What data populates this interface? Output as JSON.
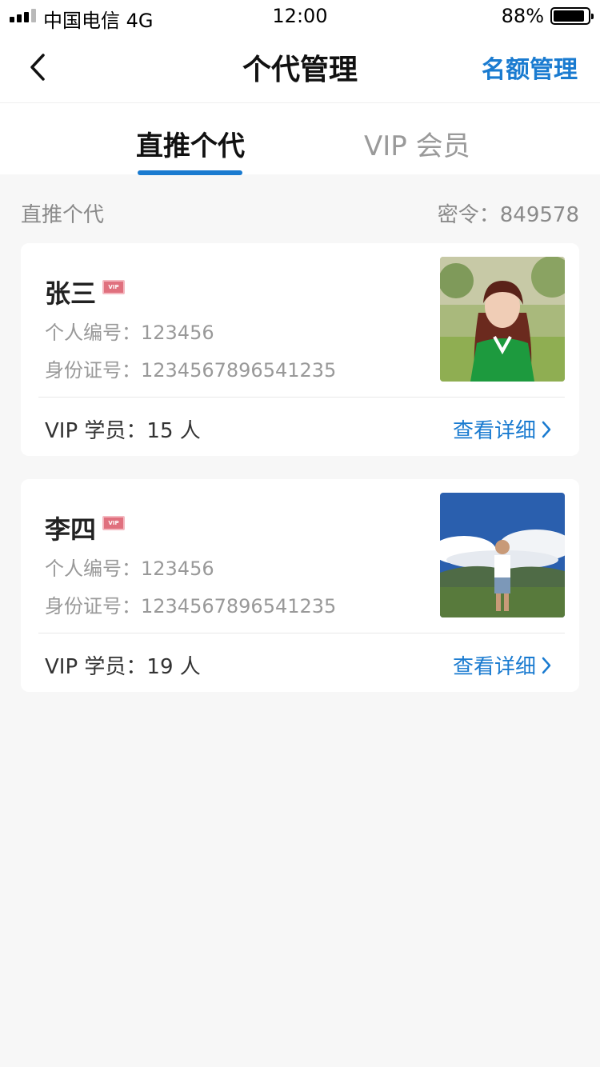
{
  "status_bar": {
    "carrier": "中国电信  4G",
    "time": "12:00",
    "battery": "88%"
  },
  "nav": {
    "title": "个代管理",
    "right_action": "名额管理"
  },
  "tabs": [
    {
      "label": "直推个代",
      "active": true
    },
    {
      "label": "VIP 会员",
      "active": false
    }
  ],
  "section": {
    "label": "直推个代",
    "code": "密令：849578"
  },
  "members": [
    {
      "name": "张三",
      "badge": "VIP",
      "id_line": "个人编号：123456",
      "idcard_line": "身份证号：1234567896541235",
      "students": "VIP 学员：15 人",
      "detail": "查看详细"
    },
    {
      "name": "李四",
      "badge": "VIP",
      "id_line": "个人编号：123456",
      "idcard_line": "身份证号：1234567896541235",
      "students": "VIP 学员：19 人",
      "detail": "查看详细"
    }
  ],
  "colors": {
    "accent": "#1a7bd0",
    "background": "#f7f7f7",
    "badge": "#e0707e"
  }
}
